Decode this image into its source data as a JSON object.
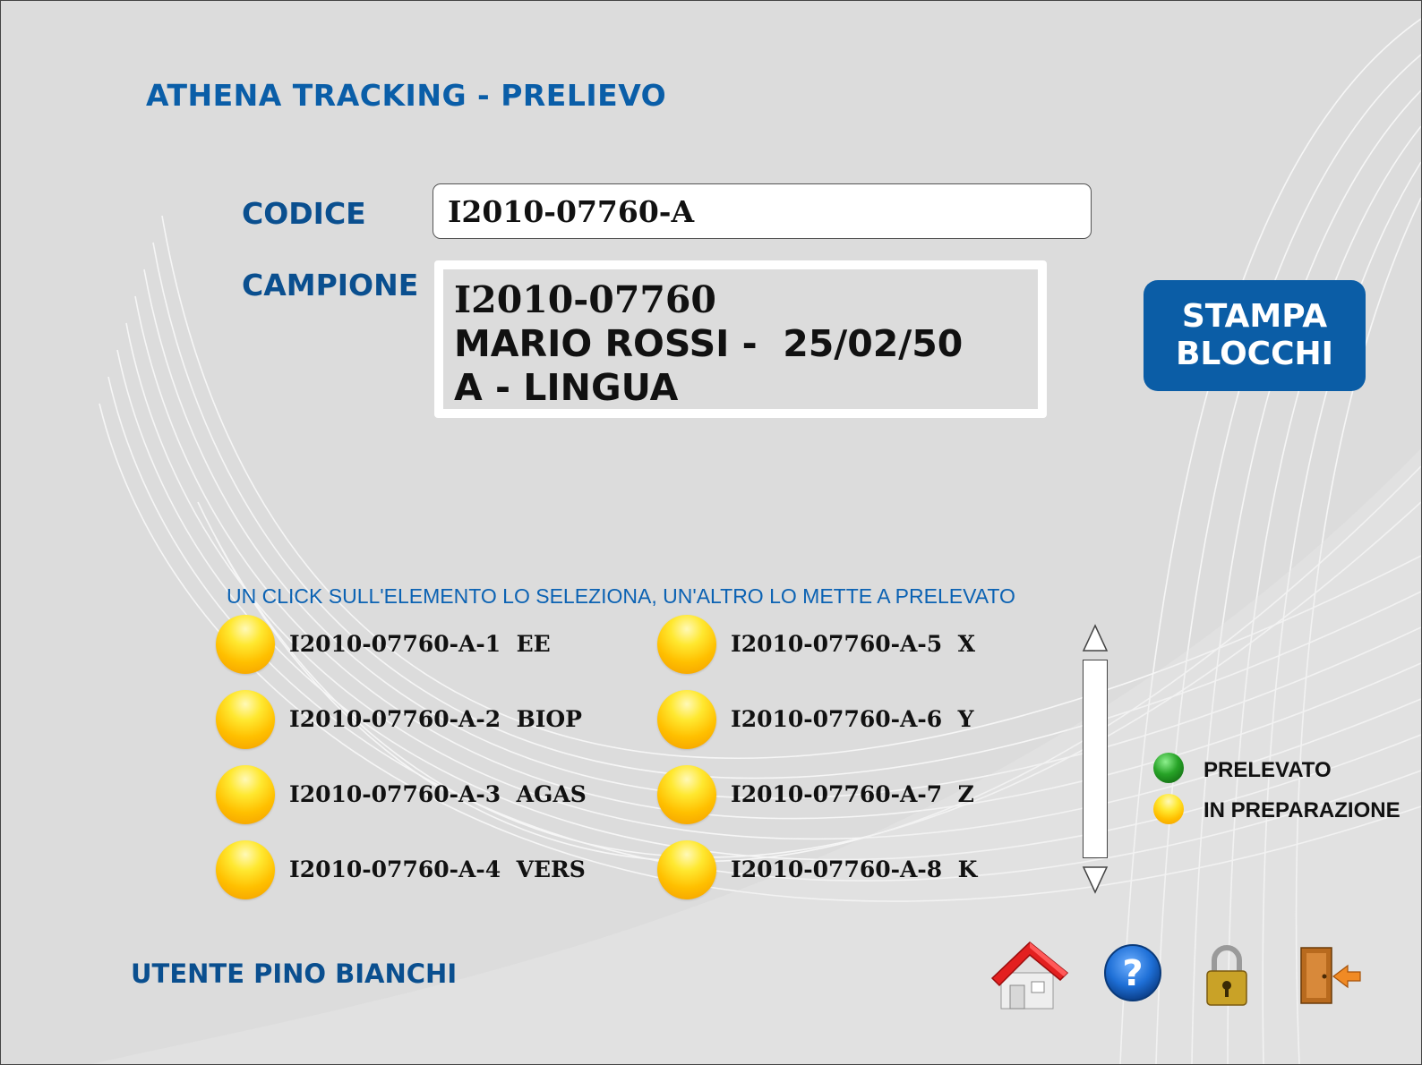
{
  "header": {
    "title": "ATHENA TRACKING - PRELIEVO"
  },
  "form": {
    "codice_label": "CODICE",
    "codice_value": "I2010-07760-A",
    "campione_label": "CAMPIONE",
    "campione_lines": [
      "I2010-07760",
      "MARIO ROSSI -  25/02/50",
      "A - LINGUA"
    ]
  },
  "actions": {
    "stampa_line1": "STAMPA",
    "stampa_line2": "BLOCCHI"
  },
  "instructions": "UN CLICK SULL'ELEMENTO LO SELEZIONA, UN'ALTRO LO METTE A  PRELEVATO",
  "blocks": [
    {
      "text": "I2010-07760-A-1  EE",
      "status": "in_preparazione"
    },
    {
      "text": "I2010-07760-A-2  BIOP",
      "status": "in_preparazione"
    },
    {
      "text": "I2010-07760-A-3  AGAS",
      "status": "in_preparazione"
    },
    {
      "text": "I2010-07760-A-4  VERS",
      "status": "in_preparazione"
    },
    {
      "text": "I2010-07760-A-5  X",
      "status": "in_preparazione"
    },
    {
      "text": "I2010-07760-A-6  Y",
      "status": "in_preparazione"
    },
    {
      "text": "I2010-07760-A-7  Z",
      "status": "in_preparazione"
    },
    {
      "text": "I2010-07760-A-8  K",
      "status": "in_preparazione"
    }
  ],
  "legend": {
    "prelevato": "PRELEVATO",
    "in_preparazione": "IN PREPARAZIONE",
    "prelevato_color": "#1a8a1a",
    "in_preparazione_color": "#ffc400"
  },
  "footer": {
    "user": "UTENTE PINO BIANCHI",
    "icons": [
      "home-icon",
      "help-icon",
      "lock-icon",
      "exit-icon"
    ]
  },
  "colors": {
    "accent": "#0b5da6",
    "background": "#dcdcdc"
  }
}
